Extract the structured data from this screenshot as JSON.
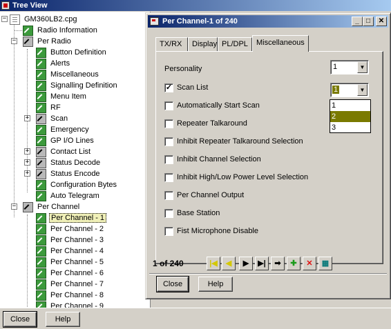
{
  "app": {
    "title": "Tree View"
  },
  "tree": {
    "root": "GM360LB2.cpg",
    "items": [
      "Radio Information",
      "Per Radio",
      "Button Definition",
      "Alerts",
      "Miscellaneous",
      "Signalling Definition",
      "Menu Item",
      "RF",
      "Scan",
      "Emergency",
      "GP I/O Lines",
      "Contact List",
      "Status Decode",
      "Status Encode",
      "Configuration Bytes",
      "Auto Telegram",
      "Per Channel",
      "Per Channel - 1",
      "Per Channel - 2",
      "Per Channel - 3",
      "Per Channel - 4",
      "Per Channel - 5",
      "Per Channel - 6",
      "Per Channel - 7",
      "Per Channel - 8",
      "Per Channel - 9"
    ]
  },
  "footer": {
    "close": "Close",
    "help": "Help"
  },
  "dialog": {
    "title": "Per Channel-1 of 240",
    "caption": {
      "minimize": "_",
      "maximize": "□",
      "close": "✕"
    },
    "tabs": [
      "TX/RX",
      "Display",
      "PL/DPL",
      "Miscellaneous"
    ],
    "active_tab": "Miscellaneous",
    "personality": {
      "label": "Personality",
      "value": "1"
    },
    "scan_list": {
      "label": "Scan List",
      "checked": true,
      "value": "1",
      "options": [
        "1",
        "2",
        "3"
      ],
      "highlighted": "2"
    },
    "checkboxes": [
      "Automatically Start Scan",
      "Repeater Talkaround",
      "Inhibit Repeater Talkaround Selection",
      "Inhibit Channel Selection",
      "Inhibit High/Low Power Level Selection",
      "Per Channel Output",
      "Base Station",
      "Fist Microphone Disable"
    ],
    "record_counter": "1 of 240",
    "nav": {
      "first": "|◀",
      "prev": "◀",
      "next": "▶",
      "last": "▶|",
      "goto": "➡",
      "add": "✚",
      "delete": "✕",
      "grid": "▦"
    },
    "close": "Close",
    "help": "Help"
  },
  "colors": {
    "title_start": "#0a246a",
    "title_end": "#a6caf0",
    "selection": "#7a7a00",
    "tree_icon_green": "#3c9a3c"
  }
}
